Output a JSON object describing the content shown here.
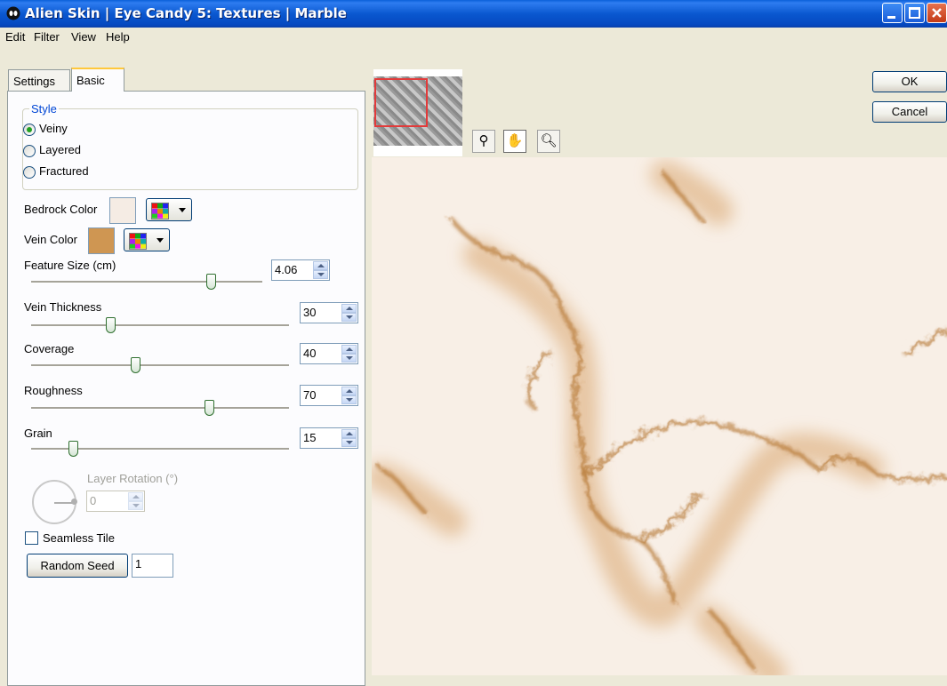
{
  "window": {
    "title": "Alien Skin | Eye Candy 5: Textures | Marble"
  },
  "menu": [
    "Edit",
    "Filter",
    "View",
    "Help"
  ],
  "tabs": [
    {
      "label": "Settings",
      "active": false
    },
    {
      "label": "Basic",
      "active": true
    }
  ],
  "style_group": {
    "label": "Style",
    "options": [
      {
        "label": "Veiny",
        "checked": true
      },
      {
        "label": "Layered",
        "checked": false
      },
      {
        "label": "Fractured",
        "checked": false
      }
    ]
  },
  "bedrock": {
    "label": "Bedrock Color",
    "color": "#f5ece4"
  },
  "vein": {
    "label": "Vein Color",
    "color": "#cf9652"
  },
  "sliders": [
    {
      "label": "Feature Size (cm)",
      "value": "4.06",
      "fraction": 0.79
    },
    {
      "label": "Vein Thickness",
      "value": "30",
      "fraction": 0.3
    },
    {
      "label": "Coverage",
      "value": "40",
      "fraction": 0.4
    },
    {
      "label": "Roughness",
      "value": "70",
      "fraction": 0.7
    },
    {
      "label": "Grain",
      "value": "15",
      "fraction": 0.15
    }
  ],
  "rotation": {
    "label": "Layer Rotation (°)",
    "value": "0"
  },
  "seamless": {
    "label": "Seamless Tile",
    "checked": false
  },
  "random_seed": {
    "button_label": "Random Seed",
    "value": "1"
  },
  "dialog_buttons": {
    "ok": "OK",
    "cancel": "Cancel"
  },
  "icons": {
    "app": "alien-skin-icon",
    "preview_tools": [
      "compare-icon",
      "hand-icon",
      "zoom-icon"
    ]
  },
  "colors": {
    "titlebar": "#0a58d0",
    "vein": "#b3732e"
  }
}
